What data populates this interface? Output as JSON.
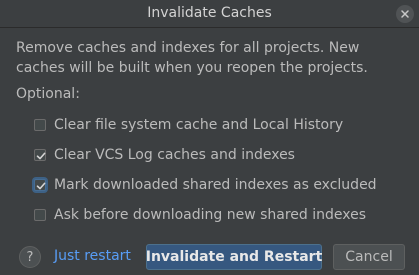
{
  "window": {
    "title": "Invalidate Caches"
  },
  "description": {
    "line1": "Remove caches and indexes for all projects. New",
    "line2": "caches will be built when you reopen the projects."
  },
  "optional_label": "Optional:",
  "options": [
    {
      "label": "Clear file system cache and Local History",
      "checked": false
    },
    {
      "label": "Clear VCS Log caches and indexes",
      "checked": true
    },
    {
      "label": "Mark downloaded shared indexes as excluded",
      "checked": true,
      "focused": true
    },
    {
      "label": "Ask before downloading new shared indexes",
      "checked": false
    }
  ],
  "footer": {
    "help_label": "?",
    "just_restart_label": "Just restart",
    "invalidate_label": "Invalidate and Restart",
    "cancel_label": "Cancel"
  },
  "colors": {
    "background": "#3c3f41",
    "text": "#bbbbbb",
    "link": "#589df6",
    "primary_button": "#365880",
    "focus_ring": "#3d6185"
  },
  "icons": {
    "close": "close-icon",
    "checkmark": "checkmark-icon"
  }
}
